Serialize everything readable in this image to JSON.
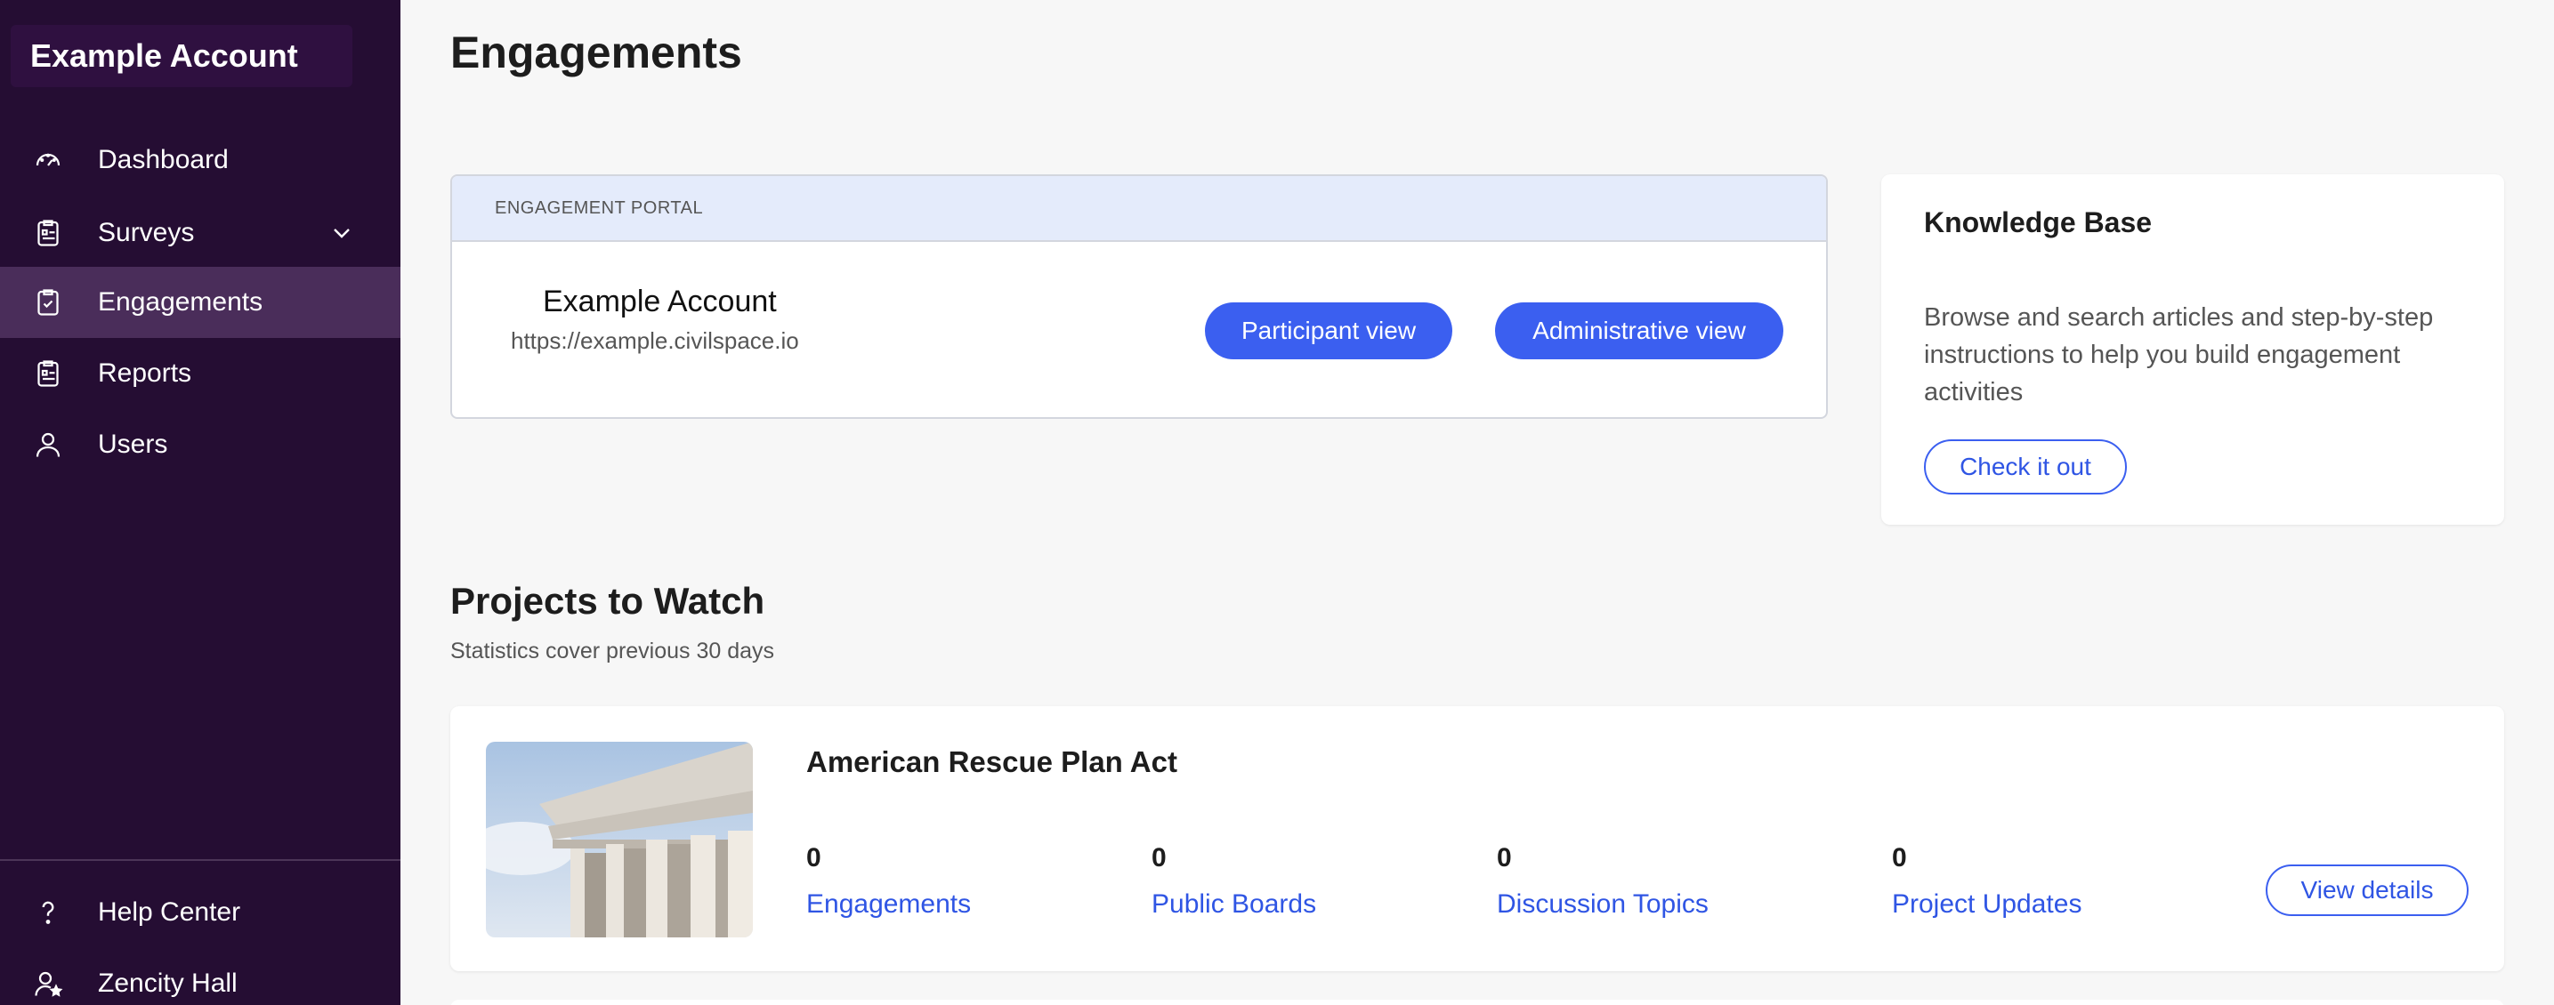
{
  "sidebar": {
    "account_name": "Example Account",
    "items": [
      {
        "label": "Dashboard",
        "icon": "gauge-icon"
      },
      {
        "label": "Surveys",
        "icon": "survey-icon",
        "expandable": true
      },
      {
        "label": "Engagements",
        "icon": "clipboard-check-icon",
        "active": true
      },
      {
        "label": "Reports",
        "icon": "report-icon"
      },
      {
        "label": "Users",
        "icon": "user-icon"
      }
    ],
    "footer_items": [
      {
        "label": "Help Center",
        "icon": "question-icon"
      },
      {
        "label": "Zencity Hall",
        "icon": "user-star-icon"
      }
    ]
  },
  "main": {
    "title": "Engagements",
    "portal": {
      "header": "ENGAGEMENT PORTAL",
      "name": "Example Account",
      "url": "https://example.civilspace.io",
      "participant_button": "Participant view",
      "admin_button": "Administrative view"
    },
    "knowledge_base": {
      "title": "Knowledge Base",
      "description": "Browse and search articles and step-by-step instructions to help you build engagement activities",
      "button": "Check it out"
    },
    "projects": {
      "title": "Projects to Watch",
      "subtitle": "Statistics cover previous 30 days",
      "items": [
        {
          "name": "American Rescue Plan Act",
          "stats": [
            {
              "value": "0",
              "label": "Engagements"
            },
            {
              "value": "0",
              "label": "Public Boards"
            },
            {
              "value": "0",
              "label": "Discussion Topics"
            },
            {
              "value": "0",
              "label": "Project Updates"
            }
          ],
          "button": "View details"
        }
      ]
    }
  },
  "colors": {
    "sidebar_bg": "#250d33",
    "sidebar_active": "#4a2d5a",
    "primary": "#3b5ff0",
    "link": "#2f55e4",
    "portal_header_bg": "#e4ebfb"
  }
}
